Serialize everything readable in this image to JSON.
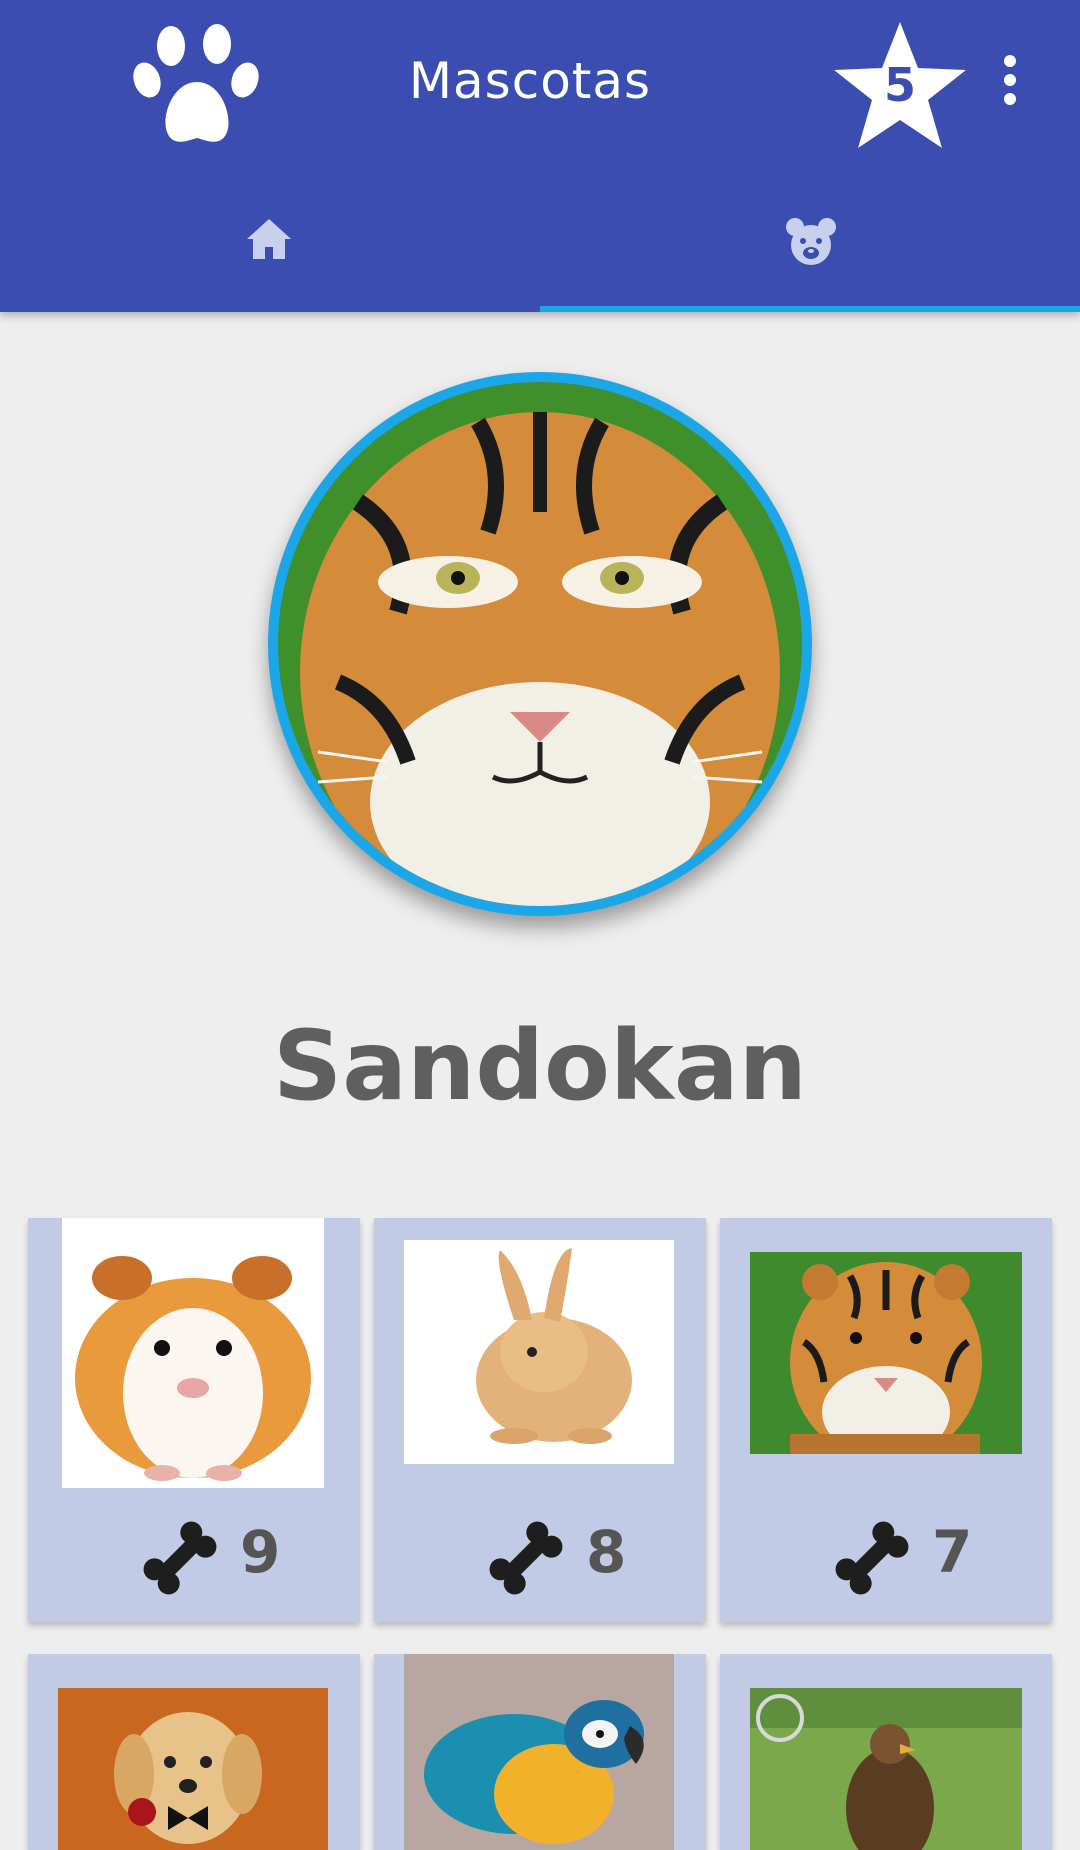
{
  "appbar": {
    "title": "Mascotas",
    "paw_icon": "paw-icon",
    "rating_icon": "star-icon",
    "rating_count": "5",
    "menu_icon": "overflow-menu-icon",
    "background_color": "#3b4db0"
  },
  "tabs": [
    {
      "icon": "home-icon",
      "selected": false
    },
    {
      "icon": "bear-face-icon",
      "selected": true
    }
  ],
  "accent_color": "#1ba6e8",
  "profile": {
    "name": "Sandokan",
    "photo": "tiger-photo"
  },
  "pets": [
    {
      "photo": "guinea-pig-photo",
      "likes": "9",
      "like_icon": "bone-icon"
    },
    {
      "photo": "rabbit-photo",
      "likes": "8",
      "like_icon": "bone-icon"
    },
    {
      "photo": "tiger-photo",
      "likes": "7",
      "like_icon": "bone-icon"
    },
    {
      "photo": "puppy-photo"
    },
    {
      "photo": "macaw-photo"
    },
    {
      "photo": "eagle-photo"
    }
  ]
}
